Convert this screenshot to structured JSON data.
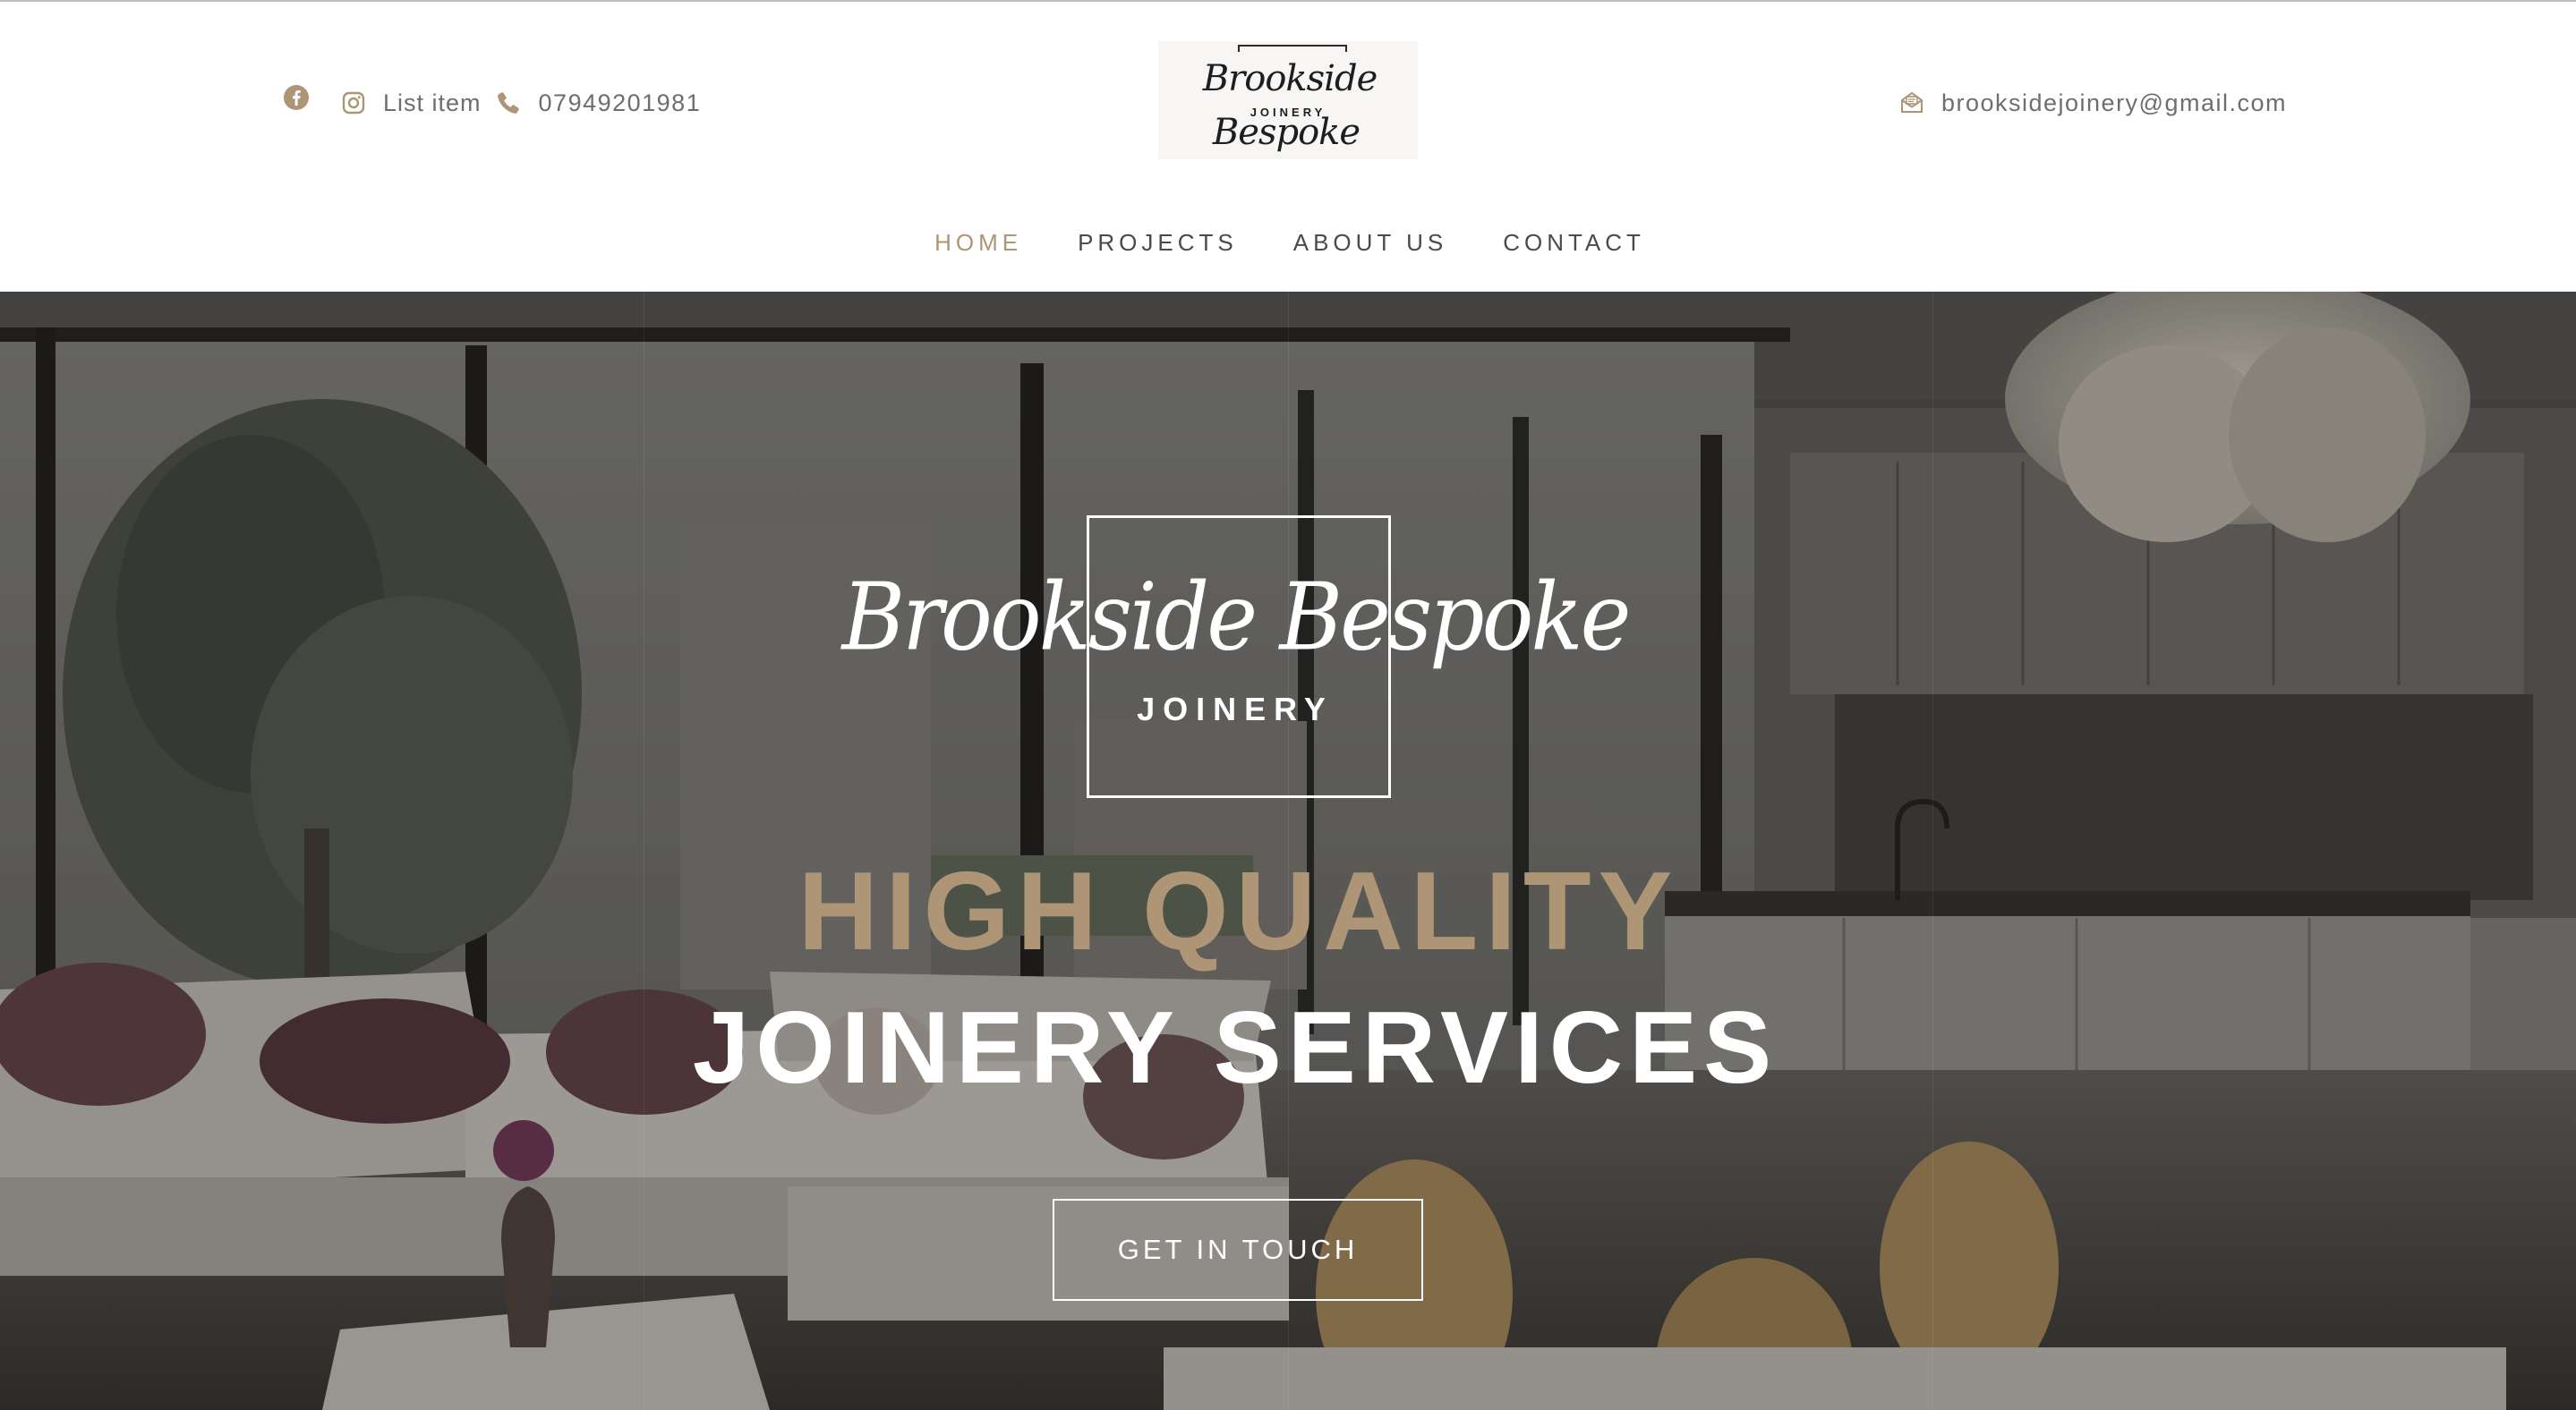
{
  "header": {
    "list_item": "List item",
    "phone": "07949201981",
    "email": "brooksidejoinery@gmail.com",
    "logo_script": "Brookside Bespoke",
    "logo_sub": "JOINERY"
  },
  "nav": {
    "items": [
      {
        "label": "HOME",
        "active": true
      },
      {
        "label": "PROJECTS",
        "active": false
      },
      {
        "label": "ABOUT US",
        "active": false
      },
      {
        "label": "CONTACT",
        "active": false
      }
    ]
  },
  "hero": {
    "logo_script": "Brookside Bespoke",
    "logo_sub": "JOINERY",
    "headline_1": "HIGH QUALITY",
    "headline_2": "JOINERY SERVICES",
    "cta_label": "GET IN TOUCH"
  },
  "colors": {
    "accent": "#ad9575",
    "nav_text": "#4a4a4a",
    "contact_text": "#6e6e6e",
    "hero_text": "#ffffff"
  },
  "icons": {
    "facebook": "facebook-icon",
    "instagram": "instagram-icon",
    "phone": "phone-icon",
    "email": "mail-icon"
  }
}
